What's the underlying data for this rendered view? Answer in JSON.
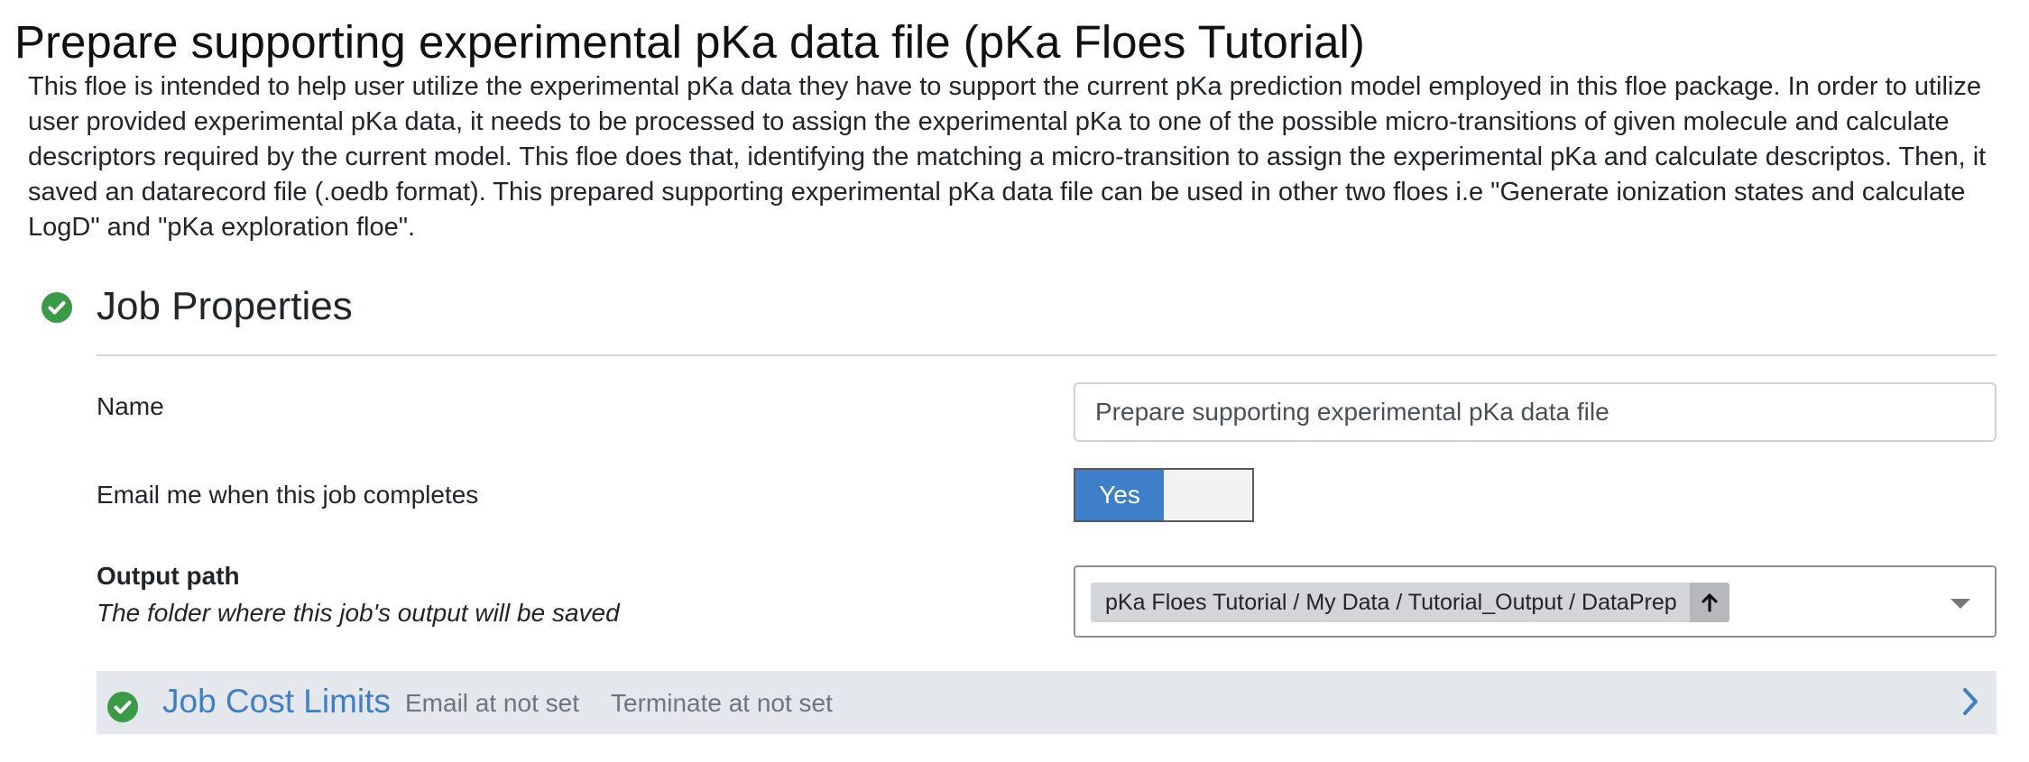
{
  "page": {
    "title": "Prepare supporting experimental pKa data file (pKa Floes Tutorial)",
    "description": "This floe is intended to help user utilize the experimental pKa data they have to support the current pKa prediction model employed in this floe package. In order to utilize user provided experimental pKa data, it needs to be processed to assign the experimental pKa to one of the possible micro-transitions of given molecule and calculate descriptors required by the current model. This floe does that, identifying the matching a micro-transition to assign the experimental pKa and calculate descriptos. Then, it saved an datarecord file (.oedb format). This prepared supporting experimental pKa data file can be used in other two floes i.e \"Generate ionization states and calculate LogD\" and \"pKa exploration floe\"."
  },
  "job_properties": {
    "title": "Job Properties",
    "status_icon": "check-circle-icon",
    "name": {
      "label": "Name",
      "value": "Prepare supporting experimental pKa data file"
    },
    "email": {
      "label": "Email me when this job completes",
      "toggle_label": "Yes",
      "checked": true
    },
    "output_path": {
      "label": "Output path",
      "help": "The folder where this job's output will be saved",
      "value": "pKa Floes Tutorial / My Data / Tutorial_Output / DataPrep",
      "up_icon": "arrow-up-icon",
      "caret_icon": "caret-down-icon"
    }
  },
  "job_cost_limits": {
    "title": "Job Cost Limits",
    "status_icon": "check-circle-icon",
    "email_at": "Email at not set",
    "terminate_at": "Terminate at not set",
    "expand_icon": "chevron-right-icon"
  },
  "colors": {
    "accent": "#3d7fc8",
    "success": "#3a9a46",
    "panel_bg": "#e4e8ec",
    "chip_bg": "#d3d5d8"
  }
}
